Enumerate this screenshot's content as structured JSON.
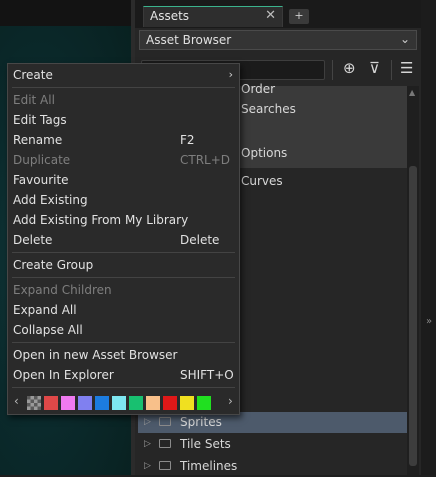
{
  "dock": {
    "tab_label": "Assets",
    "tab_close": "✕",
    "tab_add": "+",
    "browser_select": "Asset Browser",
    "select_chevron": "⌄"
  },
  "toolbar": {
    "add_icon": "⊕",
    "filter_icon": "⊽",
    "menu_icon": "☰"
  },
  "tree": {
    "partial_rows": [
      "Order",
      "Searches",
      "Options",
      "Curves"
    ],
    "items": [
      {
        "label": "Sprites",
        "selected": true
      },
      {
        "label": "Tile Sets",
        "selected": false
      },
      {
        "label": "Timelines",
        "selected": false
      }
    ]
  },
  "menu": {
    "items": [
      {
        "label": "Create",
        "shortcut": "",
        "disabled": false,
        "submenu": true
      },
      {
        "label": "Edit All",
        "shortcut": "",
        "disabled": true
      },
      {
        "label": "Edit Tags",
        "shortcut": "",
        "disabled": false
      },
      {
        "label": "Rename",
        "shortcut": "F2",
        "disabled": false
      },
      {
        "label": "Duplicate",
        "shortcut": "CTRL+D",
        "disabled": true
      },
      {
        "label": "Favourite",
        "shortcut": "",
        "disabled": false
      },
      {
        "label": "Add Existing",
        "shortcut": "",
        "disabled": false
      },
      {
        "label": "Add Existing From My Library",
        "shortcut": "",
        "disabled": false
      },
      {
        "label": "Delete",
        "shortcut": "Delete",
        "disabled": false
      },
      {
        "label": "Create Group",
        "shortcut": "",
        "disabled": false
      },
      {
        "label": "Expand Children",
        "shortcut": "",
        "disabled": true
      },
      {
        "label": "Expand All",
        "shortcut": "",
        "disabled": false
      },
      {
        "label": "Collapse All",
        "shortcut": "",
        "disabled": false
      },
      {
        "label": "Open in new Asset Browser",
        "shortcut": "",
        "disabled": false
      },
      {
        "label": "Open In Explorer",
        "shortcut": "SHIFT+O",
        "disabled": false
      }
    ],
    "submenu_arrow": "›",
    "swatch_left": "‹",
    "swatch_right": "›",
    "swatches": [
      "checker",
      "#e04848",
      "#f07af0",
      "#8080f0",
      "#1c7ce0",
      "#7ee6f0",
      "#18c070",
      "#f8c08a",
      "#e01818",
      "#f0e020",
      "#20e020"
    ]
  },
  "panel": {
    "collapse_arrow": "»"
  }
}
